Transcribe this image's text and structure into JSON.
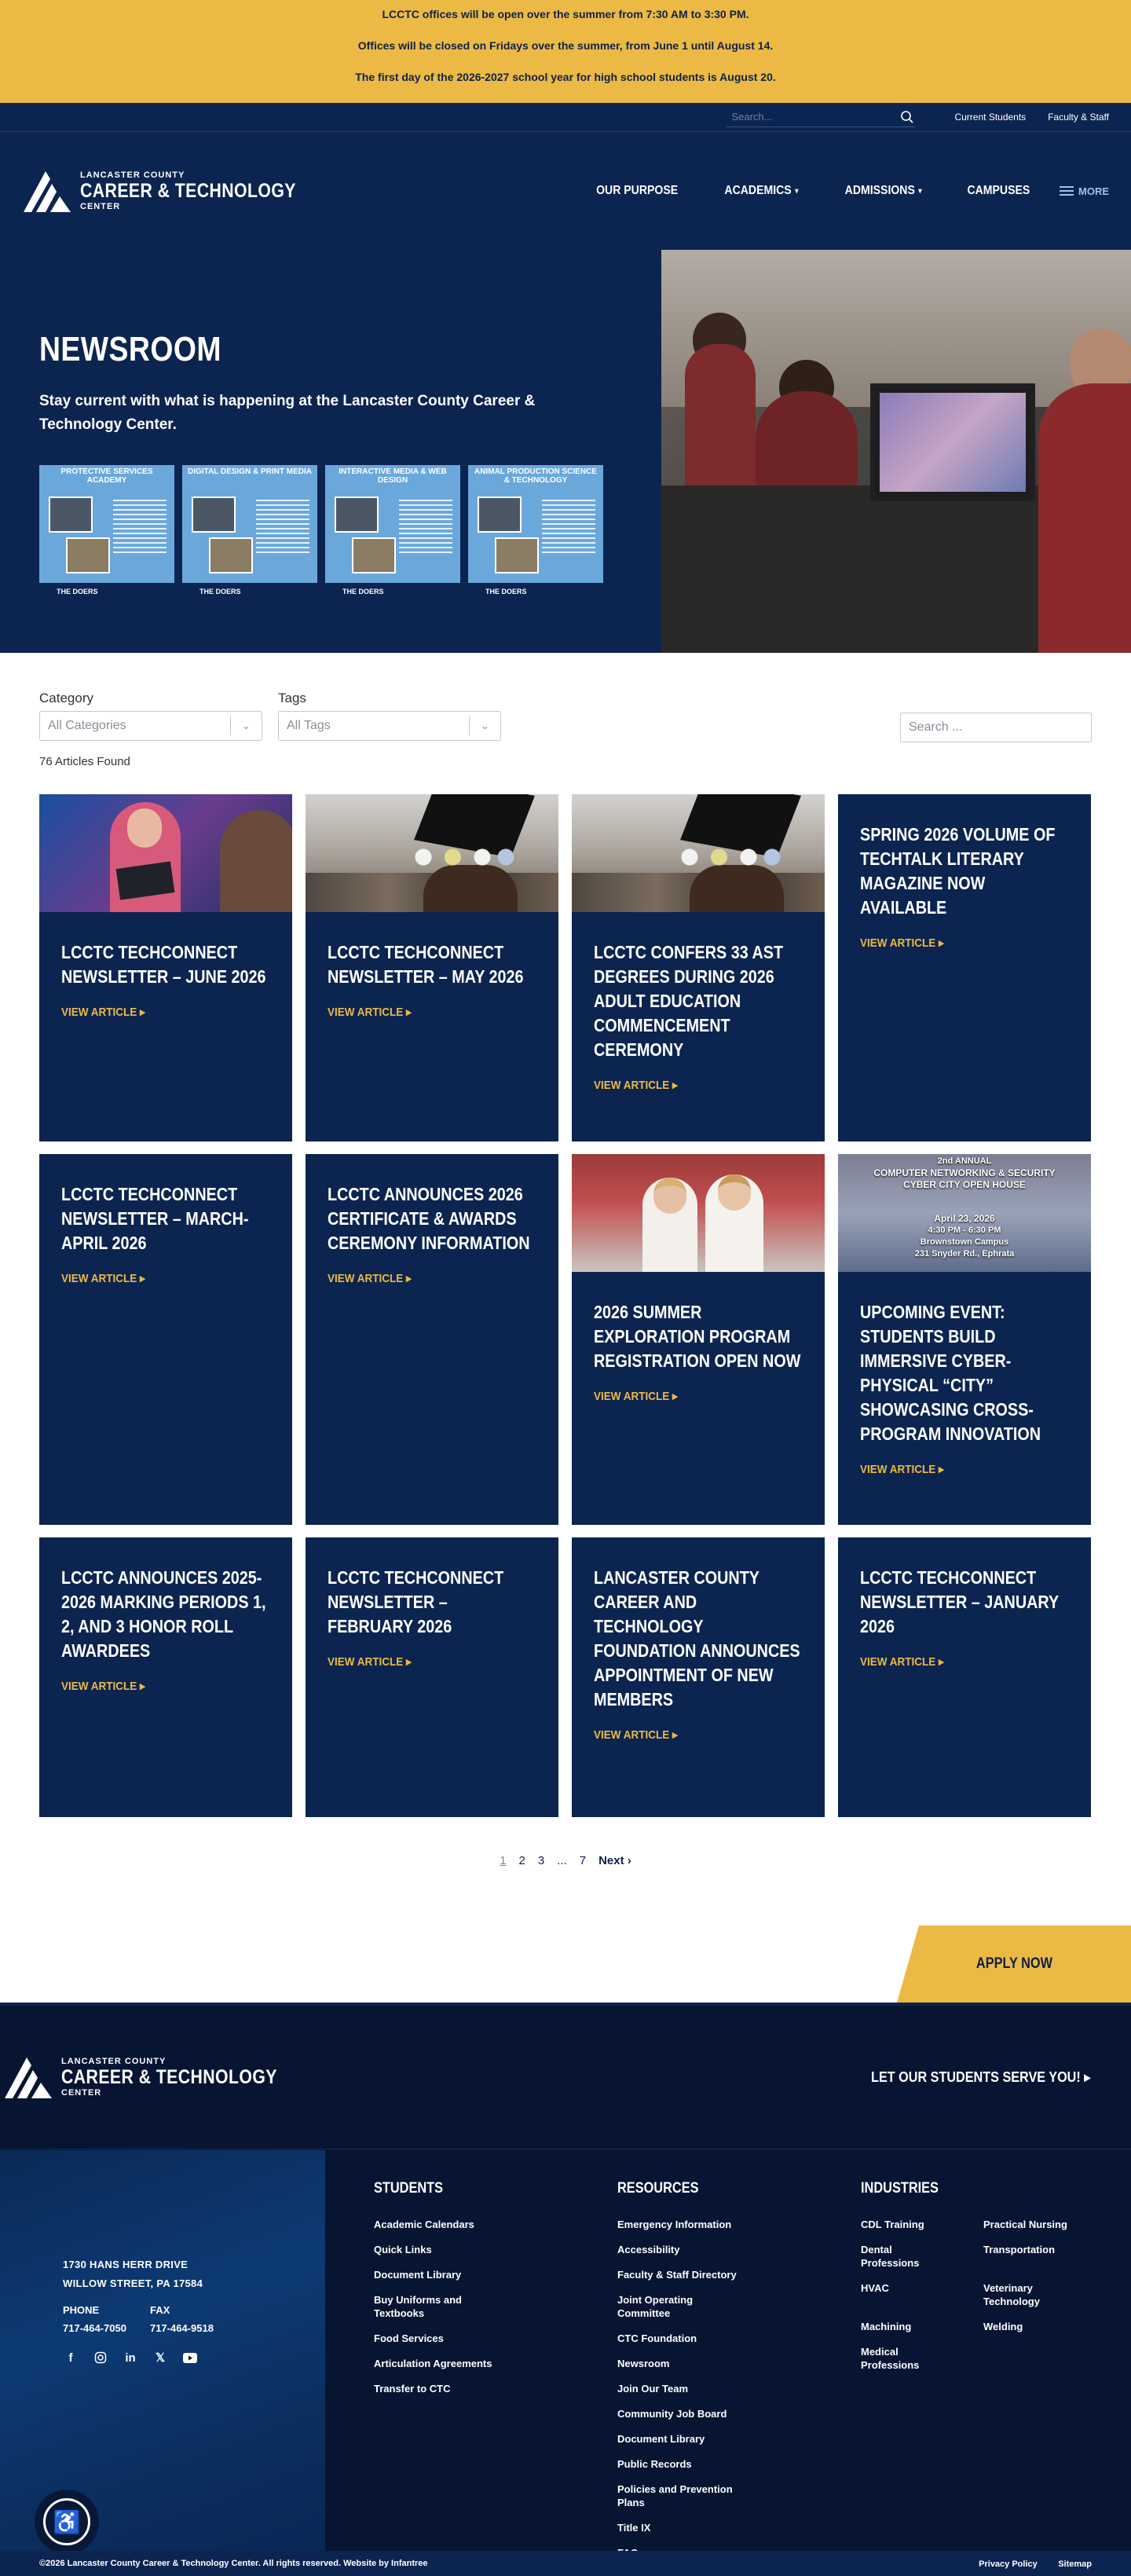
{
  "alerts": [
    "LCCTC offices will be open over the summer from 7:30 AM to 3:30 PM.",
    "Offices will be closed on Fridays over the summer, from June 1 until August 14.",
    "The first day of the 2026-2027 school year for high school students is August 20."
  ],
  "utility": {
    "search_placeholder": "Search...",
    "links": [
      "Current Students",
      "Faculty & Staff"
    ]
  },
  "logo": {
    "line1": "LANCASTER COUNTY",
    "line2": "CAREER & TECHNOLOGY",
    "line3": "CENTER"
  },
  "nav": {
    "items": [
      "OUR PURPOSE",
      "ACADEMICS",
      "ADMISSIONS",
      "CAMPUSES"
    ],
    "more": "MORE"
  },
  "hero": {
    "title": "NEWSROOM",
    "subtitle": "Stay current with what is happening at the Lancaster County Career & Technology Center.",
    "posters": [
      {
        "title": "PROTECTIVE SERVICES ACADEMY",
        "footer": "THE DOERS"
      },
      {
        "title": "DIGITAL DESIGN & PRINT MEDIA",
        "footer": "THE DOERS"
      },
      {
        "title": "INTERACTIVE MEDIA & WEB DESIGN",
        "footer": "THE DOERS"
      },
      {
        "title": "ANIMAL PRODUCTION SCIENCE & TECHNOLOGY",
        "footer": "THE DOERS"
      }
    ]
  },
  "filters": {
    "category_label": "Category",
    "category_placeholder": "All Categories",
    "tags_label": "Tags",
    "tags_placeholder": "All Tags",
    "search_placeholder": "Search ...",
    "count": "76 Articles Found"
  },
  "articles": [
    {
      "title": "LCCTC TechConnect Newsletter – June 2026",
      "link": "VIEW ARTICLE ▸"
    },
    {
      "title": "LCCTC TechConnect Newsletter – May 2026",
      "link": "VIEW ARTICLE ▸"
    },
    {
      "title": "LCCTC Confers 33 AST Degrees During 2026 Adult Education Commencement Ceremony",
      "link": "VIEW ARTICLE ▸"
    },
    {
      "title": "Spring 2026 Volume of TechTalk Literary Magazine Now Available",
      "link": "VIEW ARTICLE ▸"
    },
    {
      "title": "LCCTC TechConnect Newsletter – March-April 2026",
      "link": "VIEW ARTICLE ▸"
    },
    {
      "title": "LCCTC Announces 2026 Certificate & Awards Ceremony Information",
      "link": "VIEW ARTICLE ▸"
    },
    {
      "title": "2026 Summer Exploration Program Registration Open Now",
      "link": "VIEW ARTICLE ▸"
    },
    {
      "title": "Upcoming Event: Students Build Immersive Cyber-Physical “City” Showcasing Cross-Program Innovation",
      "link": "VIEW ARTICLE ▸"
    },
    {
      "title": "LCCTC Announces 2025-2026 Marking Periods 1, 2, and 3 Honor Roll Awardees",
      "link": "VIEW ARTICLE ▸"
    },
    {
      "title": "LCCTC TechConnect Newsletter – February 2026",
      "link": "VIEW ARTICLE ▸"
    },
    {
      "title": "Lancaster County Career and Technology Foundation Announces Appointment of New Members",
      "link": "VIEW ARTICLE ▸"
    },
    {
      "title": "LCCTC TechConnect Newsletter – January 2026",
      "link": "VIEW ARTICLE ▸"
    }
  ],
  "cyber_image": {
    "line1": "2nd ANNUAL",
    "line2": "COMPUTER NETWORKING & SECURITY",
    "line3": "CYBER CITY OPEN HOUSE",
    "line4": "April 23, 2026",
    "line5": "4:30 PM - 6:30 PM",
    "line6": "Brownstown Campus",
    "line7": "231 Snyder Rd., Ephrata"
  },
  "pagination": {
    "pages": [
      "1",
      "2",
      "3",
      "...",
      "7"
    ],
    "next": "Next ›"
  },
  "apply": "APPLY NOW",
  "footer": {
    "serve": "LET OUR STUDENTS SERVE YOU! ▸",
    "address1": "1730 HANS HERR DRIVE",
    "address2": "WILLOW STREET, PA 17584",
    "phone_label": "PHONE",
    "phone": "717-464-7050",
    "fax_label": "FAX",
    "fax": "717-464-9518",
    "students": {
      "title": "STUDENTS",
      "links": [
        "Academic Calendars",
        "Quick Links",
        "Document Library",
        "Buy Uniforms and Textbooks",
        "Food Services",
        "Articulation Agreements",
        "Transfer to CTC"
      ]
    },
    "resources": {
      "title": "RESOURCES",
      "links": [
        "Emergency Information",
        "Accessibility",
        "Faculty & Staff Directory",
        "Joint Operating Committee",
        "CTC Foundation",
        "Newsroom",
        "Join Our Team",
        "Community Job Board",
        "Document Library",
        "Public Records",
        "Policies and Prevention Plans",
        "Title IX",
        "FAQs"
      ]
    },
    "industries": {
      "title": "INDUSTRIES",
      "links": [
        "CDL Training",
        "Practical Nursing",
        "Dental Professions",
        "Transportation",
        "HVAC",
        "Veterinary Technology",
        "Machining",
        "Welding",
        "Medical Professions"
      ]
    },
    "copyright": "©2026 Lancaster County Career & Technology Center. All rights reserved. Website by Infantree",
    "privacy": "Privacy Policy",
    "sitemap": "Sitemap"
  },
  "colors": {
    "navy": "#0c2450",
    "gold": "#ecb945",
    "footer": "#071533"
  }
}
